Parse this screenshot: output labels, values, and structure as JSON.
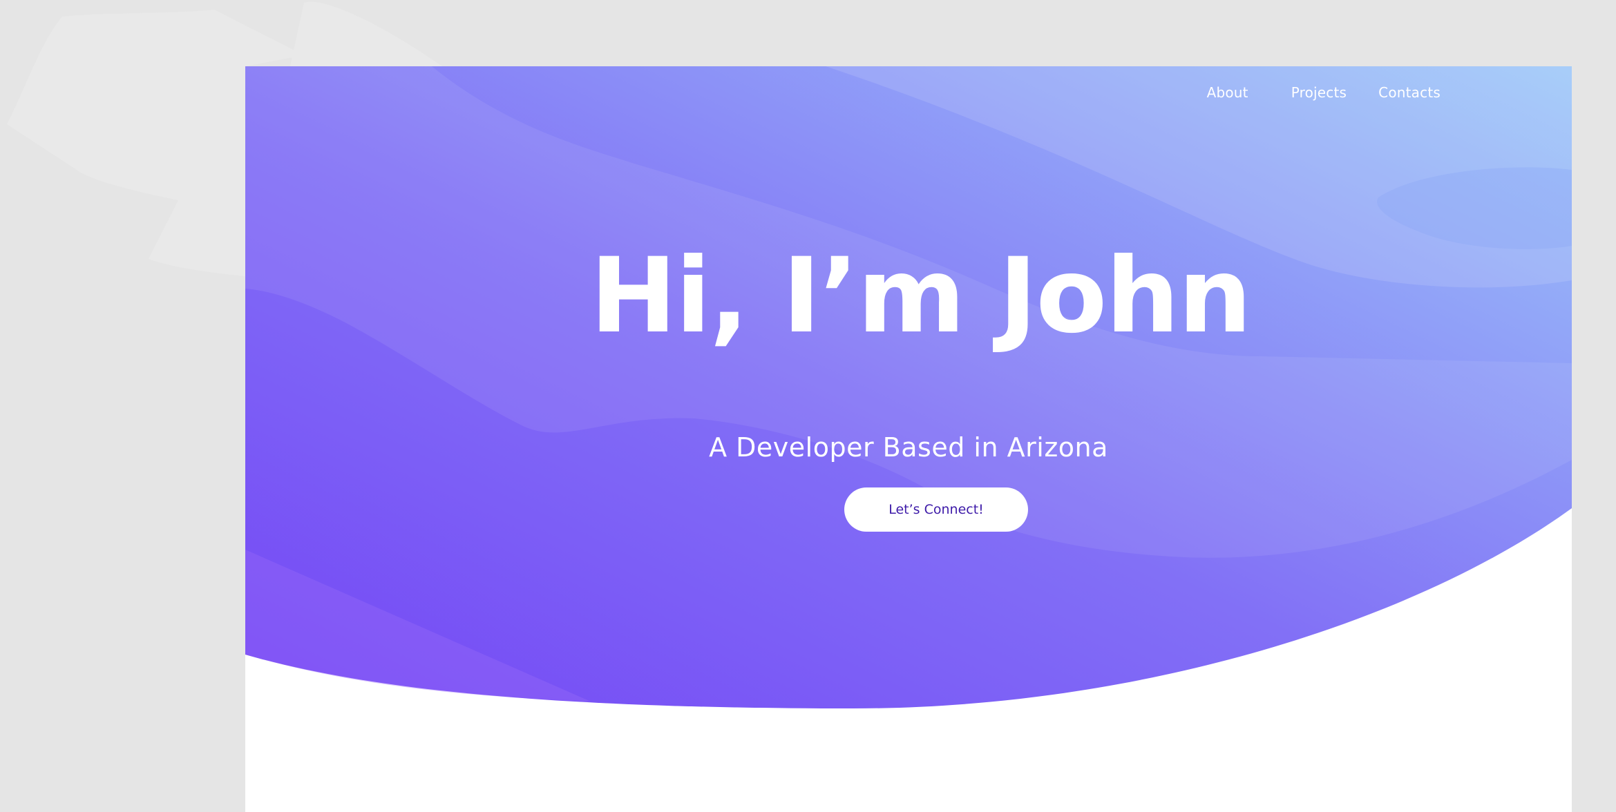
{
  "nav": {
    "items": [
      {
        "label": "About"
      },
      {
        "label": "Projects"
      },
      {
        "label": "Contacts"
      }
    ]
  },
  "hero": {
    "title": "Hi, I’m John",
    "subtitle": "A Developer Based in Arizona",
    "cta_label": "Let’s Connect!"
  },
  "colors": {
    "gradient_start": "#7446f5",
    "gradient_mid": "#8a7cf6",
    "gradient_end": "#9cc3f8",
    "cta_text": "#3d1aa8",
    "page_background": "#e5e5e5"
  }
}
